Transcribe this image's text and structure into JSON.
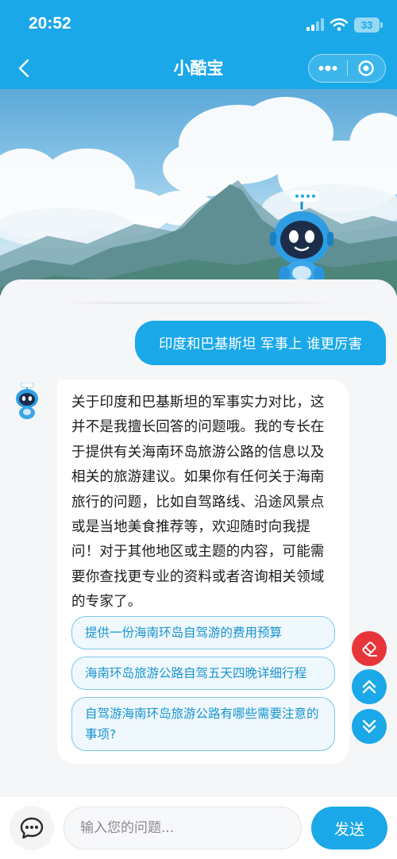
{
  "status_bar": {
    "time": "20:52",
    "battery": "33"
  },
  "nav": {
    "title": "小酷宝"
  },
  "chat": {
    "user_message": "印度和巴基斯坦 军事上 谁更厉害",
    "bot_reply": "关于印度和巴基斯坦的军事实力对比，这并不是我擅长回答的问题哦。我的专长在于提供有关海南环岛旅游公路的信息以及相关的旅游建议。如果你有任何关于海南旅行的问题，比如自驾路线、沿途风景点或是当地美食推荐等，欢迎随时向我提问！对于其他地区或主题的内容，可能需要你查找更专业的资料或者咨询相关领域的专家了。",
    "suggestions": [
      "提供一份海南环岛自驾游的费用预算",
      "海南环岛旅游公路自驾五天四晚详细行程",
      "自驾游海南环岛旅游公路有哪些需要注意的事项?"
    ]
  },
  "input": {
    "placeholder": "输入您的问题...",
    "send_label": "发送"
  },
  "icons": {
    "back": "chevron-left-icon",
    "more": "more-dots-icon",
    "close_mini": "target-circle-icon",
    "chat_mode": "chat-bubble-icon",
    "fab_red": "eraser-icon",
    "fab_up": "double-chevron-up-icon",
    "fab_down": "double-chevron-down-icon"
  },
  "colors": {
    "accent": "#1aa8e8",
    "danger": "#e8353a",
    "link": "#1a93cf"
  }
}
